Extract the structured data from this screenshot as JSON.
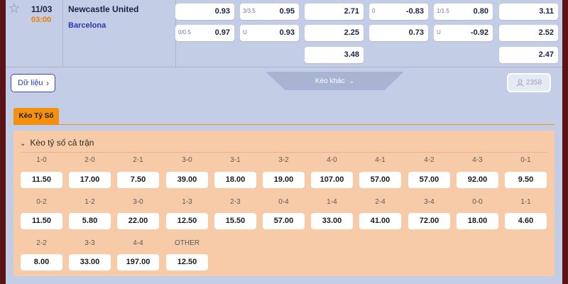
{
  "match": {
    "date": "11/03",
    "time": "03:00",
    "home_team": "Newcastle United",
    "away_team": "Barcelona",
    "odds_rows": [
      [
        {
          "handicap": "",
          "value": "0.93"
        },
        {
          "handicap": "3/3.5",
          "value": "0.95"
        },
        {
          "handicap": "",
          "value": "2.71"
        },
        {
          "handicap": "0",
          "value": "-0.83"
        },
        {
          "handicap": "1/1.5",
          "value": "0.80"
        },
        {
          "handicap": "",
          "value": "3.11"
        }
      ],
      [
        {
          "handicap": "0/0.5",
          "value": "0.97"
        },
        {
          "handicap": "U",
          "value": "0.93"
        },
        {
          "handicap": "",
          "value": "2.25"
        },
        {
          "handicap": "",
          "value": "0.73"
        },
        {
          "handicap": "U",
          "value": "-0.92"
        },
        {
          "handicap": "",
          "value": "2.52"
        }
      ],
      [
        {
          "handicap": "",
          "value": "3.48"
        },
        {
          "handicap": "",
          "value": "2.47"
        }
      ]
    ]
  },
  "actions": {
    "data_button": "Dữ liệu",
    "more_bets": "Kèo khác",
    "viewer_count": "2358"
  },
  "tab": {
    "label": "Kèo Tỷ Số"
  },
  "correct_score": {
    "title": "Kèo tỷ số cả trận",
    "rows": [
      [
        {
          "score": "1-0",
          "odds": "11.50"
        },
        {
          "score": "2-0",
          "odds": "17.00"
        },
        {
          "score": "2-1",
          "odds": "7.50"
        },
        {
          "score": "3-0",
          "odds": "39.00"
        },
        {
          "score": "3-1",
          "odds": "18.00"
        },
        {
          "score": "3-2",
          "odds": "19.00"
        },
        {
          "score": "4-0",
          "odds": "107.00"
        },
        {
          "score": "4-1",
          "odds": "57.00"
        },
        {
          "score": "4-2",
          "odds": "57.00"
        },
        {
          "score": "4-3",
          "odds": "92.00"
        },
        {
          "score": "0-1",
          "odds": "9.50"
        }
      ],
      [
        {
          "score": "0-2",
          "odds": "11.50"
        },
        {
          "score": "1-2",
          "odds": "5.80"
        },
        {
          "score": "3-0",
          "odds": "22.00"
        },
        {
          "score": "1-3",
          "odds": "12.50"
        },
        {
          "score": "2-3",
          "odds": "15.50"
        },
        {
          "score": "0-4",
          "odds": "57.00"
        },
        {
          "score": "1-4",
          "odds": "33.00"
        },
        {
          "score": "2-4",
          "odds": "41.00"
        },
        {
          "score": "3-4",
          "odds": "72.00"
        },
        {
          "score": "0-0",
          "odds": "18.00"
        },
        {
          "score": "1-1",
          "odds": "4.60"
        }
      ],
      [
        {
          "score": "2-2",
          "odds": "8.00"
        },
        {
          "score": "3-3",
          "odds": "33.00"
        },
        {
          "score": "4-4",
          "odds": "197.00"
        },
        {
          "score": "OTHER",
          "odds": "12.50"
        }
      ]
    ]
  },
  "icons": {
    "favorite": "star-icon",
    "data_chevron": "chevron-right-icon",
    "more_chevron": "chevron-down-icon",
    "viewers": "user-icon",
    "collapse": "chevron-down-icon"
  },
  "colors": {
    "accent": "#f4900c",
    "kickoff_time": "#f07c00",
    "away_team": "#2a3aa8",
    "panel_bg": "#f8cba8",
    "page_bg": "#c4cde6"
  }
}
